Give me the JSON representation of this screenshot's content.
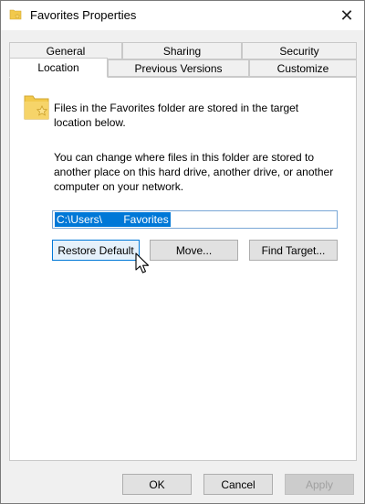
{
  "window": {
    "title": "Favorites Properties"
  },
  "tabs": {
    "row_top": [
      "General",
      "Sharing",
      "Security"
    ],
    "row_bottom": [
      "Location",
      "Previous Versions",
      "Customize"
    ],
    "active": "Location"
  },
  "panel": {
    "intro_line1": "Files in the Favorites folder are stored in the target",
    "intro_line2": "location below.",
    "desc_line1": "You can change where files in this folder are stored to",
    "desc_line2": "another place on this hard drive, another drive, or another",
    "desc_line3": "computer on your network.",
    "path_value": "C:\\Users\\       Favorites",
    "buttons": {
      "restore": "Restore Default",
      "move": "Move...",
      "find": "Find Target..."
    }
  },
  "footer": {
    "ok": "OK",
    "cancel": "Cancel",
    "apply": "Apply"
  },
  "colors": {
    "accent": "#0078d7",
    "folder": "#f2c94c"
  },
  "icons": {
    "title": "folder-star-icon",
    "panel": "folder-star-icon",
    "close": "close-icon",
    "cursor": "mouse-pointer-icon"
  }
}
